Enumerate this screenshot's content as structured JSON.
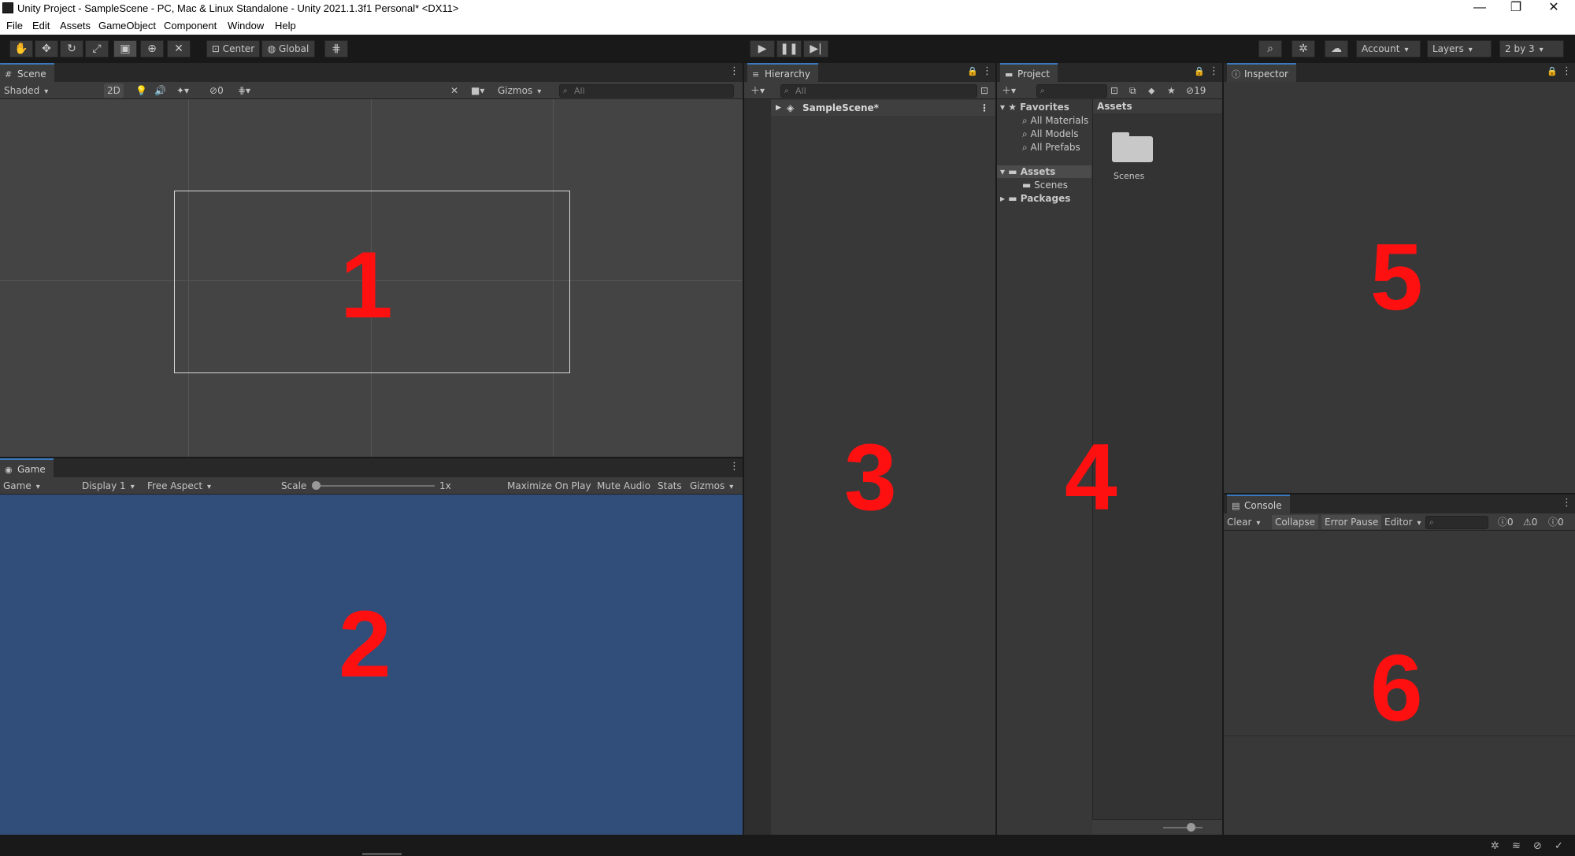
{
  "window": {
    "title": "Unity Project - SampleScene - PC, Mac & Linux Standalone - Unity 2021.1.3f1 Personal* <DX11>",
    "minimize": "—",
    "maximize": "❐",
    "close": "✕"
  },
  "menu": [
    "File",
    "Edit",
    "Assets",
    "GameObject",
    "Component",
    "Window",
    "Help"
  ],
  "toolbar": {
    "pivot": "Center",
    "space": "Global",
    "account": "Account",
    "layers": "Layers",
    "layout": "2 by 3"
  },
  "scene": {
    "tab": "Scene",
    "shading": "Shaded",
    "mode_2d": "2D",
    "hidden_count": "0",
    "gizmos": "Gizmos",
    "search_placeholder": "All",
    "marker": "1"
  },
  "game": {
    "tab": "Game",
    "view_mode": "Game",
    "display": "Display 1",
    "aspect": "Free Aspect",
    "scale_label": "Scale",
    "scale_value": "1x",
    "maximize_on_play": "Maximize On Play",
    "mute_audio": "Mute Audio",
    "stats": "Stats",
    "gizmos": "Gizmos",
    "marker": "2"
  },
  "hierarchy": {
    "tab": "Hierarchy",
    "search_placeholder": "All",
    "scene_item": "SampleScene*",
    "marker": "3"
  },
  "project": {
    "tab": "Project",
    "hidden_count": "19",
    "tree": {
      "favorites": "Favorites",
      "all_materials": "All Materials",
      "all_models": "All Models",
      "all_prefabs": "All Prefabs",
      "assets": "Assets",
      "scenes": "Scenes",
      "packages": "Packages"
    },
    "files_header": "Assets",
    "folder_name": "Scenes",
    "marker": "4"
  },
  "inspector": {
    "tab": "Inspector",
    "marker": "5"
  },
  "console": {
    "tab": "Console",
    "clear": "Clear",
    "collapse": "Collapse",
    "error_pause": "Error Pause",
    "editor": "Editor",
    "log_count": "0",
    "warning_count": "0",
    "error_count": "0",
    "marker": "6"
  }
}
